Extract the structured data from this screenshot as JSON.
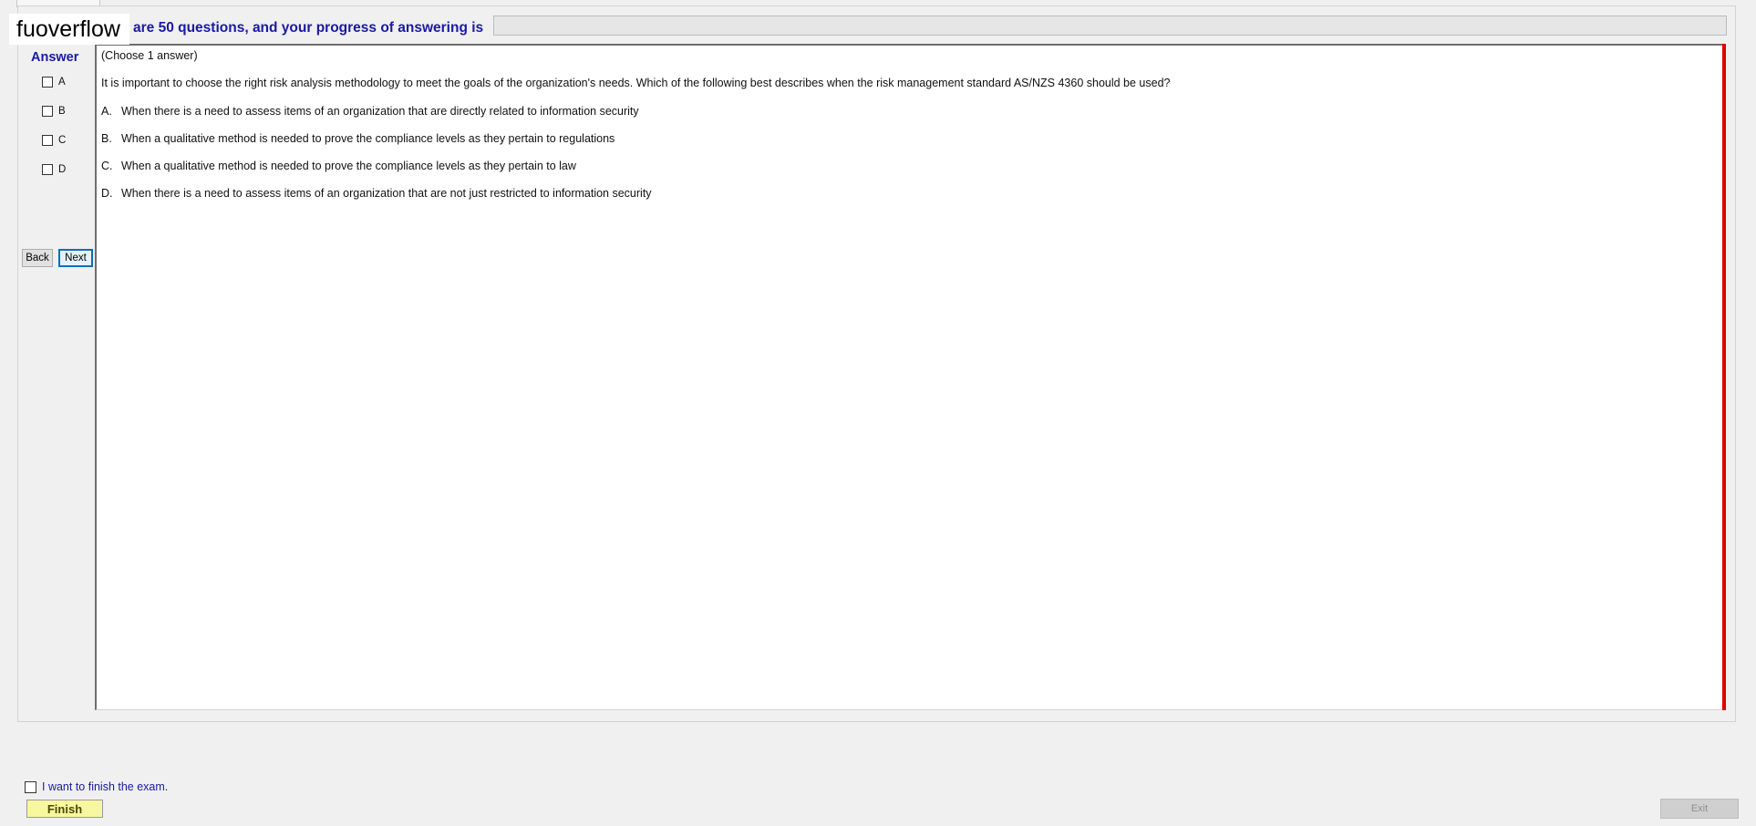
{
  "overlay": {
    "watermark": "fuoverflow"
  },
  "header": {
    "progress_text": "are 50 questions, and your progress of answering is",
    "progress_fraction": 0
  },
  "answer_panel": {
    "title": "Answer",
    "options": [
      "A",
      "B",
      "C",
      "D"
    ],
    "back_label": "Back",
    "next_label": "Next"
  },
  "question": {
    "instruction": "(Choose 1 answer)",
    "stem": "It is important to choose the right risk analysis methodology to meet the goals of the organization's needs. Which of the following best describes when the risk management standard AS/NZS 4360 should be used?",
    "choices": [
      {
        "letter": "A.",
        "text": "When there is a need to assess items of an organization that are directly related to information security"
      },
      {
        "letter": "B.",
        "text": "When a qualitative method is needed to prove the compliance levels as they pertain to regulations"
      },
      {
        "letter": "C.",
        "text": "When a qualitative method is needed to prove the compliance levels as they pertain to law"
      },
      {
        "letter": "D.",
        "text": "When there is a need to assess items of an organization that are not just restricted to information security"
      }
    ]
  },
  "footer": {
    "finish_checkbox_label": "I want to finish the exam.",
    "finish_label": "Finish",
    "exit_label": "Exit"
  },
  "colors": {
    "accent_blue": "#1a1aa0",
    "panel_red_edge": "#e00000",
    "finish_yellow": "#f7f7a0"
  }
}
